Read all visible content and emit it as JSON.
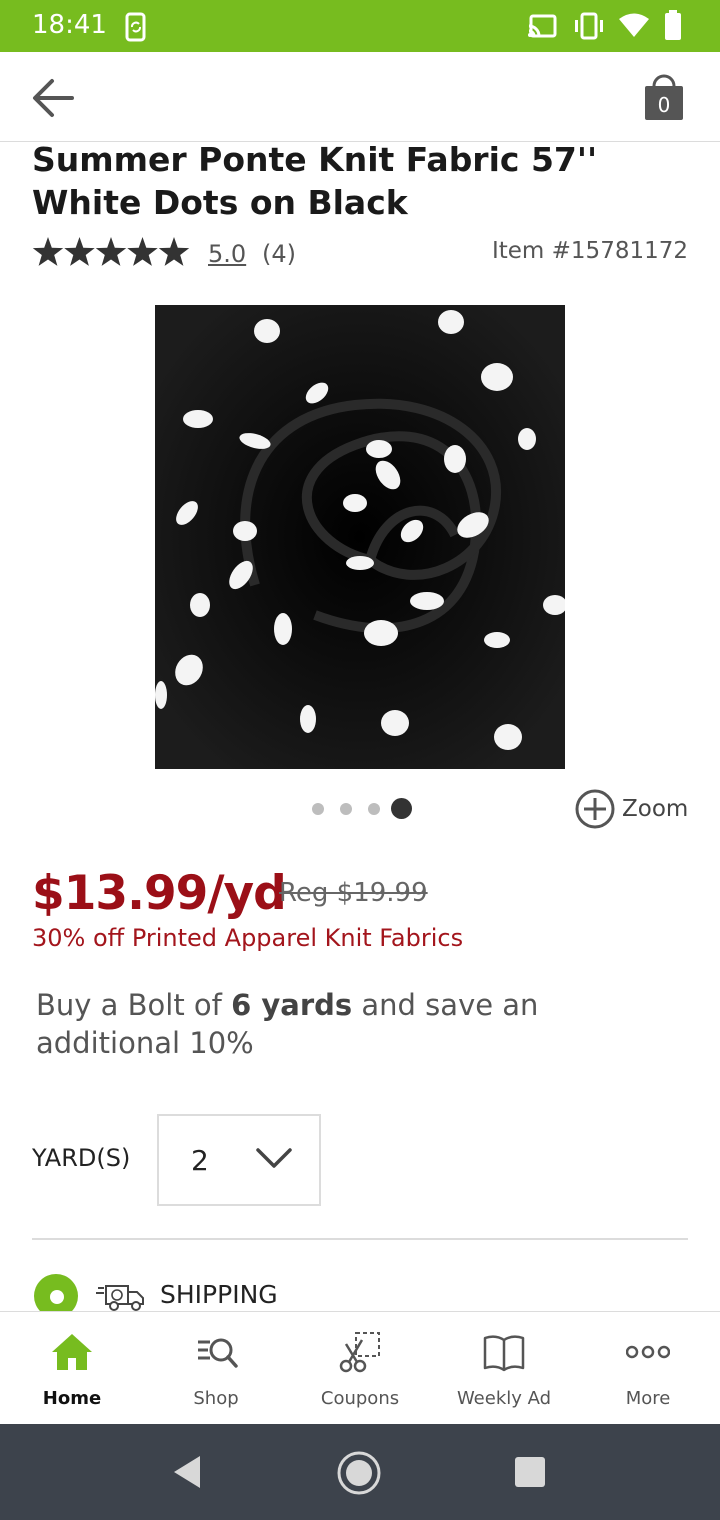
{
  "status_bar": {
    "time": "18:41"
  },
  "header": {
    "cart_count": "0"
  },
  "product": {
    "title": "Summer Ponte Knit Fabric 57'' White Dots on Black",
    "rating": "5.0",
    "rating_stars": 5,
    "review_count": "(4)",
    "item_number": "Item #15781172",
    "price": "$13.99/yd",
    "regular_price": "Reg $19.99",
    "promo": "30% off Printed Apparel Knit Fabrics",
    "bolt_prefix": "Buy a Bolt of ",
    "bolt_bold": "6 yards",
    "bolt_suffix": " and save an additional 10%"
  },
  "carousel": {
    "image_count": 4,
    "active_index": 3,
    "zoom_label": "Zoom"
  },
  "quantity": {
    "label": "YARD(S)",
    "value": "2"
  },
  "fulfillment": {
    "shipping_label": "SHIPPING"
  },
  "bottom_nav": {
    "items": [
      {
        "label": "Home",
        "icon": "home-icon",
        "active": true
      },
      {
        "label": "Shop",
        "icon": "shop-search-icon",
        "active": false
      },
      {
        "label": "Coupons",
        "icon": "coupon-scissors-icon",
        "active": false
      },
      {
        "label": "Weekly Ad",
        "icon": "book-icon",
        "active": false
      },
      {
        "label": "More",
        "icon": "more-icon",
        "active": false
      }
    ]
  },
  "colors": {
    "brand_green": "#77bc1f",
    "price_red": "#9b0f17",
    "system_nav": "#3d434c"
  }
}
